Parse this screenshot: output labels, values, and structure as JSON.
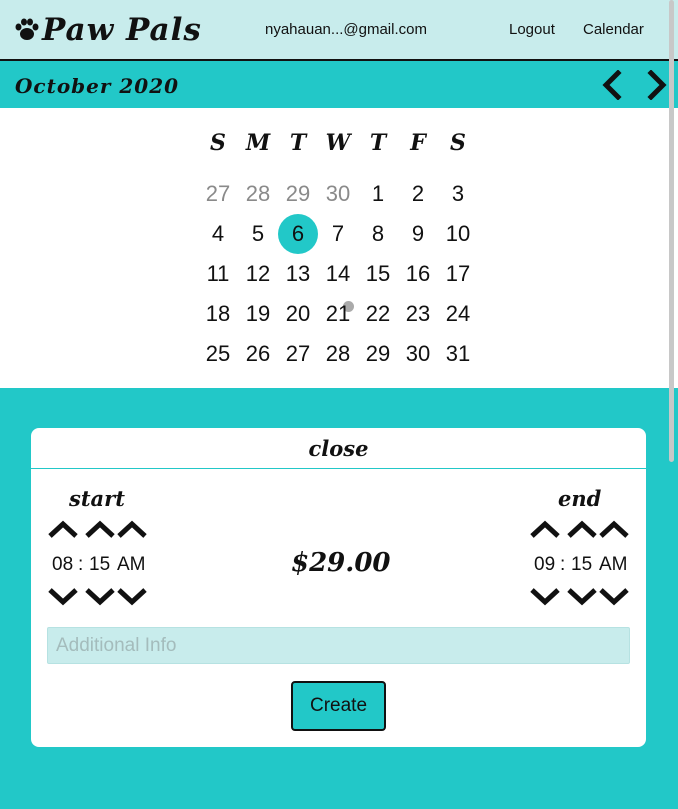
{
  "header": {
    "brand": "Paw Pals",
    "brand_icon": "paw-icon",
    "email": "nyahauan...@gmail.com",
    "logout_label": "Logout",
    "calendar_label": "Calendar"
  },
  "month_bar": {
    "title": "October 2020",
    "prev_icon": "chevron-left-icon",
    "next_icon": "chevron-right-icon"
  },
  "calendar": {
    "weekdays": [
      "S",
      "M",
      "T",
      "W",
      "T",
      "F",
      "S"
    ],
    "weeks": [
      [
        "27",
        "28",
        "29",
        "30",
        "1",
        "2",
        "3"
      ],
      [
        "4",
        "5",
        "6",
        "7",
        "8",
        "9",
        "10"
      ],
      [
        "11",
        "12",
        "13",
        "14",
        "15",
        "16",
        "17"
      ],
      [
        "18",
        "19",
        "20",
        "21",
        "22",
        "23",
        "24"
      ],
      [
        "25",
        "26",
        "27",
        "28",
        "29",
        "30",
        "31"
      ]
    ],
    "selected_day": "6",
    "accent_color": "#22c8c8"
  },
  "booking": {
    "close_label": "close",
    "start_label": "start",
    "end_label": "end",
    "start": {
      "hour": "08",
      "separator": ":",
      "minute": "15",
      "period": "AM"
    },
    "end": {
      "hour": "09",
      "separator": ":",
      "minute": "15",
      "period": "AM"
    },
    "price": "$29.00",
    "info_placeholder": "Additional Info",
    "info_value": "",
    "create_label": "Create"
  },
  "colors": {
    "teal": "#22c8c8",
    "light_teal": "#c8ecec"
  }
}
